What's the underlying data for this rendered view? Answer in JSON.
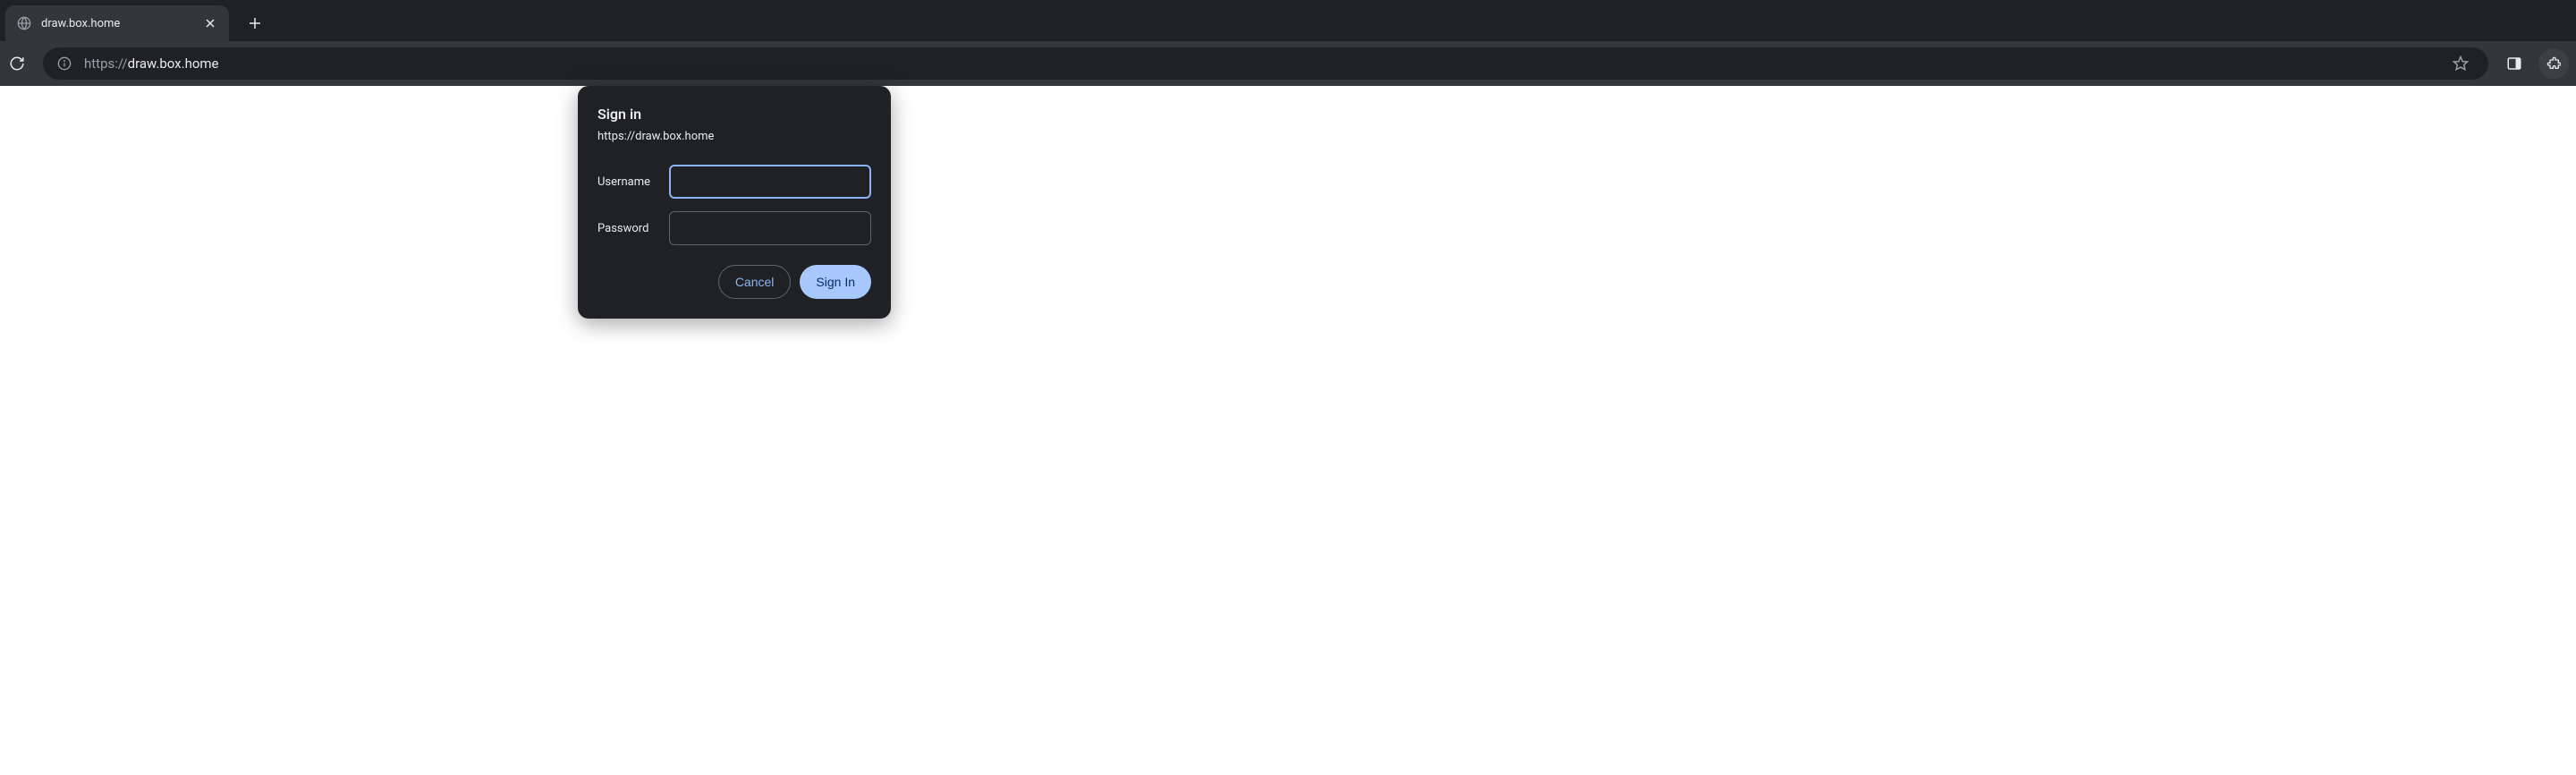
{
  "tab": {
    "title": "draw.box.home"
  },
  "address": {
    "scheme": "https://",
    "host": "draw.box.home"
  },
  "dialog": {
    "title": "Sign in",
    "origin": "https://draw.box.home",
    "username_label": "Username",
    "password_label": "Password",
    "username_value": "",
    "password_value": "",
    "cancel_label": "Cancel",
    "signin_label": "Sign In"
  }
}
